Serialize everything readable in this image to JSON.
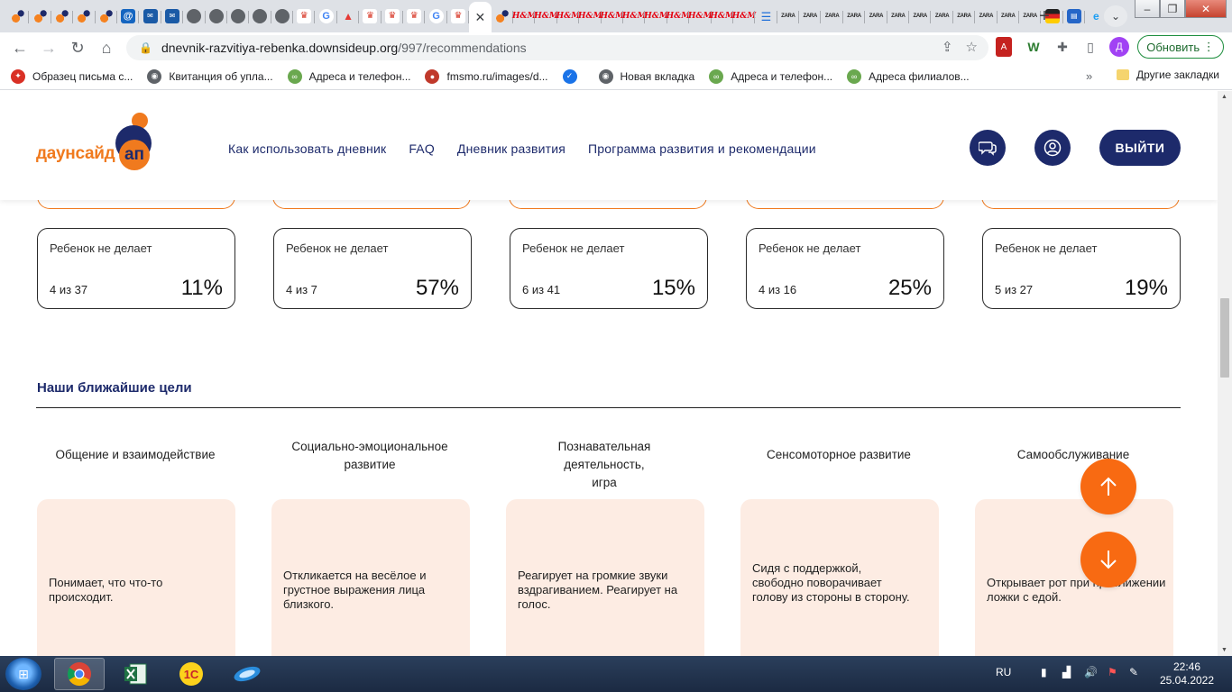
{
  "browser": {
    "tabs": [
      {
        "kind": "k-dsu"
      },
      {
        "kind": "k-dsu"
      },
      {
        "kind": "k-dsu"
      },
      {
        "kind": "k-dsu"
      },
      {
        "kind": "k-dsu"
      },
      {
        "kind": "k-at",
        "glyph": "@"
      },
      {
        "kind": "k-mail",
        "glyph": "✉"
      },
      {
        "kind": "k-mail",
        "glyph": "✉"
      },
      {
        "kind": "k-globe"
      },
      {
        "kind": "k-globe"
      },
      {
        "kind": "k-globe"
      },
      {
        "kind": "k-globe"
      },
      {
        "kind": "k-globe"
      },
      {
        "kind": "k-crown",
        "glyph": "♛"
      },
      {
        "kind": "k-g",
        "glyph": "G"
      },
      {
        "kind": "k-tri",
        "glyph": "▲"
      },
      {
        "kind": "k-crown",
        "glyph": "♛"
      },
      {
        "kind": "k-crown",
        "glyph": "♛"
      },
      {
        "kind": "k-crown",
        "glyph": "♛"
      },
      {
        "kind": "k-g",
        "glyph": "G"
      },
      {
        "kind": "k-crown",
        "glyph": "♛"
      },
      {
        "kind": "active-close",
        "glyph": "✕"
      },
      {
        "kind": "k-dsu"
      },
      {
        "kind": "k-hm",
        "glyph": "H&M"
      },
      {
        "kind": "k-hm",
        "glyph": "H&M"
      },
      {
        "kind": "k-hm",
        "glyph": "H&M"
      },
      {
        "kind": "k-hm",
        "glyph": "H&M"
      },
      {
        "kind": "k-hm",
        "glyph": "H&M"
      },
      {
        "kind": "k-hm",
        "glyph": "H&M"
      },
      {
        "kind": "k-hm",
        "glyph": "H&M"
      },
      {
        "kind": "k-hm",
        "glyph": "H&M"
      },
      {
        "kind": "k-hm",
        "glyph": "H&M"
      },
      {
        "kind": "k-hm",
        "glyph": "H&M"
      },
      {
        "kind": "k-hm",
        "glyph": "H&M"
      },
      {
        "kind": "k-lines",
        "glyph": "☰"
      },
      {
        "kind": "k-zara",
        "glyph": "ZARA"
      },
      {
        "kind": "k-zara",
        "glyph": "ZARA"
      },
      {
        "kind": "k-zara",
        "glyph": "ZARA"
      },
      {
        "kind": "k-zara",
        "glyph": "ZARA"
      },
      {
        "kind": "k-zara",
        "glyph": "ZARA"
      },
      {
        "kind": "k-zara",
        "glyph": "ZARA"
      },
      {
        "kind": "k-zara",
        "glyph": "ZARA"
      },
      {
        "kind": "k-zara",
        "glyph": "ZARA"
      },
      {
        "kind": "k-zara",
        "glyph": "ZARA"
      },
      {
        "kind": "k-zara",
        "glyph": "ZARA"
      },
      {
        "kind": "k-zara",
        "glyph": "ZARA"
      },
      {
        "kind": "k-zara",
        "glyph": "ZARA"
      },
      {
        "kind": "k-flag"
      },
      {
        "kind": "k-book",
        "glyph": "▤"
      },
      {
        "kind": "k-ie",
        "glyph": "e"
      }
    ],
    "url_host": "dnevnik-razvitiya-rebenka.downsideup.org",
    "url_path": "/997/recommendations",
    "profile_initial": "Д",
    "update_label": "Обновить",
    "bookmarks": [
      {
        "label": "Образец письма с...",
        "color": "#d93025",
        "glyph": "✦"
      },
      {
        "label": "Квитанция об упла...",
        "color": "#5f6368",
        "glyph": "◉"
      },
      {
        "label": "Адреса и телефон...",
        "color": "#6aa84f",
        "glyph": "∞"
      },
      {
        "label": "fmsmo.ru/images/d...",
        "color": "#c0392b",
        "glyph": "●"
      },
      {
        "label": "",
        "color": "#1a73e8",
        "glyph": "✓"
      },
      {
        "label": "Новая вкладка",
        "color": "#5f6368",
        "glyph": "◉"
      },
      {
        "label": "Адреса и телефон...",
        "color": "#6aa84f",
        "glyph": "∞"
      },
      {
        "label": "Адреса филиалов...",
        "color": "#6aa84f",
        "glyph": "∞"
      }
    ],
    "other_bookmarks": "Другие закладки"
  },
  "site": {
    "logo_text": "даунсайд",
    "logo_badge": "ап",
    "nav": [
      "Как использовать дневник",
      "FAQ",
      "Дневник развития",
      "Программа развития и рекомендации"
    ],
    "logout_label": "ВЫЙТИ"
  },
  "stats": [
    {
      "label": "Ребенок не делает",
      "fraction": "4 из 37",
      "percent": "11%"
    },
    {
      "label": "Ребенок не делает",
      "fraction": "4 из 7",
      "percent": "57%"
    },
    {
      "label": "Ребенок не делает",
      "fraction": "6 из 41",
      "percent": "15%"
    },
    {
      "label": "Ребенок не делает",
      "fraction": "4 из 16",
      "percent": "25%"
    },
    {
      "label": "Ребенок не делает",
      "fraction": "5 из 27",
      "percent": "19%"
    }
  ],
  "goals": {
    "title": "Наши ближайшие цели",
    "categories": [
      {
        "name": "Общение и взаимодействие",
        "goal": "Понимает, что что-то происходит."
      },
      {
        "name": "Социально-эмоциональное развитие",
        "goal": "Откликается на весёлое и грустное выражения лица близкого."
      },
      {
        "name": "Познавательная деятельность, игра",
        "goal": "Реагирует на громкие звуки вздрагиванием. Реагирует на голос."
      },
      {
        "name": "Сенсомоторное развитие",
        "goal": "Сидя с поддержкой, свободно поворачивает голову из стороны в сторону."
      },
      {
        "name": "Самообслуживание",
        "goal": "Открывает рот при приближении ложки с едой."
      }
    ]
  },
  "colors": {
    "brand_navy": "#1d2a6b",
    "brand_orange": "#f07a1e",
    "fab_orange": "#f86a12",
    "card_peach": "#fdece3"
  },
  "taskbar": {
    "apps": [
      {
        "name": "chrome",
        "active": true
      },
      {
        "name": "excel",
        "active": false
      },
      {
        "name": "1c",
        "active": false
      },
      {
        "name": "remote",
        "active": false
      }
    ],
    "lang": "RU",
    "time": "22:46",
    "date": "25.04.2022"
  }
}
